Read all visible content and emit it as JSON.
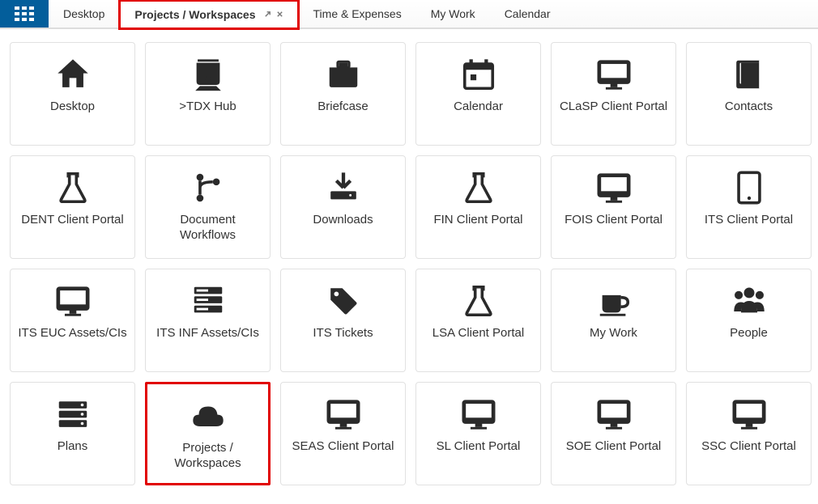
{
  "topbar": {
    "tabs": [
      {
        "label": "Desktop",
        "active": false,
        "closable": false
      },
      {
        "label": "Projects / Workspaces",
        "active": true,
        "closable": true,
        "highlight": true
      },
      {
        "label": "Time & Expenses",
        "active": false,
        "closable": false
      },
      {
        "label": "My Work",
        "active": false,
        "closable": false
      },
      {
        "label": "Calendar",
        "active": false,
        "closable": false
      }
    ],
    "app_menu_name": "app-launcher-icon"
  },
  "tiles": [
    {
      "label": "Desktop",
      "icon": "home-icon"
    },
    {
      "label": ">TDX Hub",
      "icon": "train-icon"
    },
    {
      "label": "Briefcase",
      "icon": "briefcase-icon"
    },
    {
      "label": "Calendar",
      "icon": "calendar-icon"
    },
    {
      "label": "CLaSP Client Portal",
      "icon": "monitor-icon"
    },
    {
      "label": "Contacts",
      "icon": "book-icon"
    },
    {
      "label": "DENT Client Portal",
      "icon": "flask-icon"
    },
    {
      "label": "Document Workflows",
      "icon": "branch-icon"
    },
    {
      "label": "Downloads",
      "icon": "download-icon"
    },
    {
      "label": "FIN Client Portal",
      "icon": "flask-icon"
    },
    {
      "label": "FOIS Client Portal",
      "icon": "monitor-icon"
    },
    {
      "label": "ITS Client Portal",
      "icon": "tablet-icon"
    },
    {
      "label": "ITS EUC Assets/CIs",
      "icon": "monitor-icon"
    },
    {
      "label": "ITS INF Assets/CIs",
      "icon": "servers-icon"
    },
    {
      "label": "ITS Tickets",
      "icon": "tag-icon"
    },
    {
      "label": "LSA Client Portal",
      "icon": "flask-icon"
    },
    {
      "label": "My Work",
      "icon": "coffee-icon"
    },
    {
      "label": "People",
      "icon": "people-icon"
    },
    {
      "label": "Plans",
      "icon": "bars-icon"
    },
    {
      "label": "Projects / Workspaces",
      "icon": "cloud-icon",
      "highlight": true
    },
    {
      "label": "SEAS Client Portal",
      "icon": "monitor-icon"
    },
    {
      "label": "SL Client Portal",
      "icon": "monitor-icon"
    },
    {
      "label": "SOE Client Portal",
      "icon": "monitor-icon"
    },
    {
      "label": "SSC Client Portal",
      "icon": "monitor-icon"
    }
  ],
  "highlight_color": "#e10000"
}
